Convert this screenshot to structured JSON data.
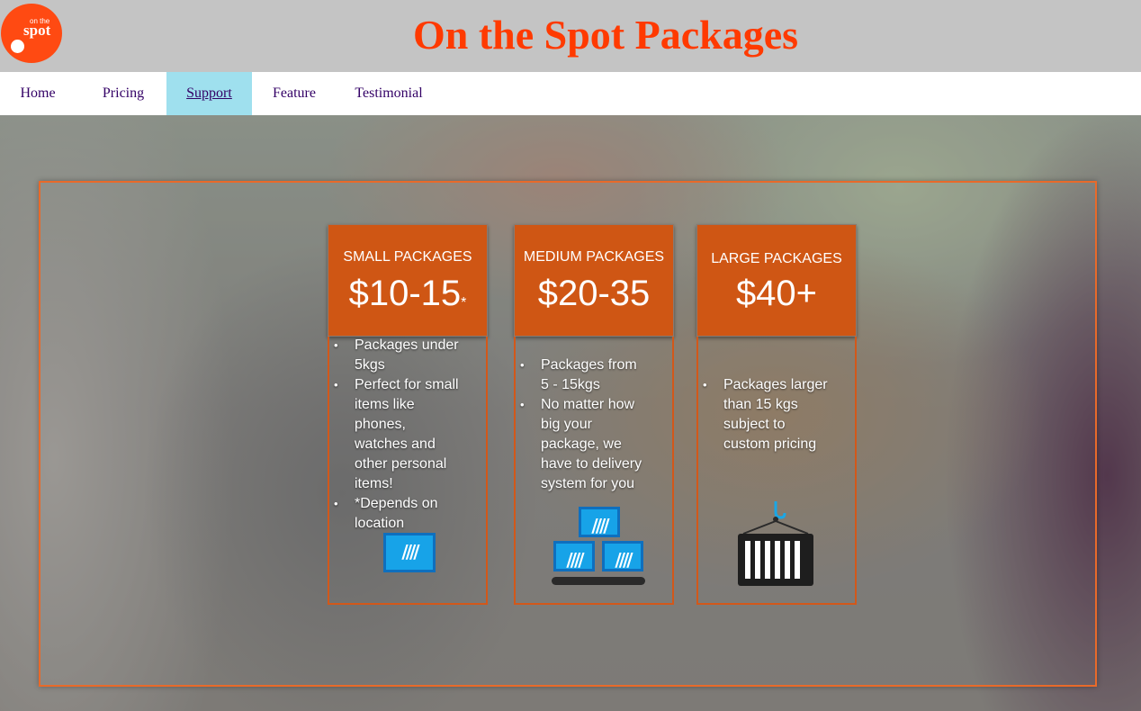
{
  "header": {
    "logo_small": "on the",
    "logo_main": "spot",
    "title": "On the Spot Packages",
    "title_color": "#ff3a00"
  },
  "nav": {
    "items": [
      {
        "label": "Home"
      },
      {
        "label": "Pricing"
      },
      {
        "label": "Support"
      },
      {
        "label": "Feature"
      },
      {
        "label": "Testimonial"
      }
    ],
    "active": "Support",
    "active_bg": "#9fe0ee"
  },
  "cards": [
    {
      "name": "SMALL PACKAGES",
      "price": "$10-15",
      "price_mark": "*",
      "features": [
        "Packages under 5kgs",
        "Perfect for small items like phones, watches and other personal items!",
        "*Depends on location"
      ],
      "icon": "single-crate-icon"
    },
    {
      "name": "MEDIUM PACKAGES",
      "price": "$20-35",
      "price_mark": "",
      "features": [
        "Packages from 5 - 15kgs",
        "No matter how big your package, we have to delivery system for you"
      ],
      "icon": "stacked-crates-icon"
    },
    {
      "name": "LARGE PACKAGES",
      "price": "$40+",
      "price_mark": "",
      "features": [
        "Packages larger than 15 kgs subject to custom pricing"
      ],
      "icon": "shipping-container-icon"
    }
  ],
  "colors": {
    "accent": "#cf5614",
    "logo": "#ff4a12",
    "crate_blue": "#17a3e8"
  }
}
